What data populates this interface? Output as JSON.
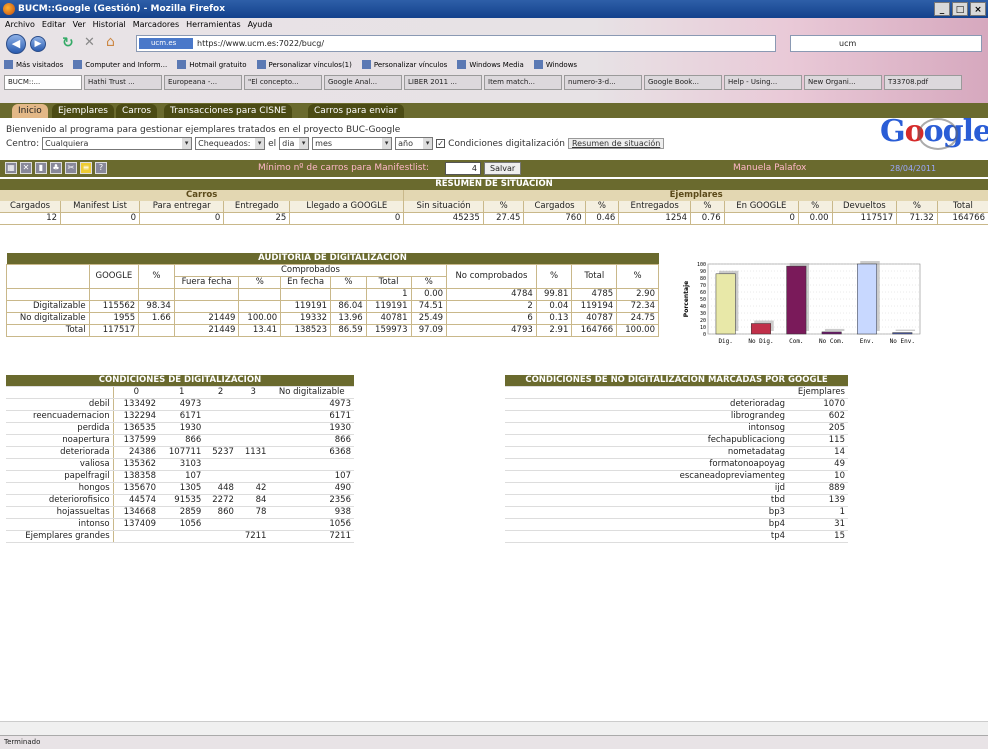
{
  "window": {
    "title": "BUCM::Google (Gestión) - Mozilla Firefox",
    "controls": [
      "_",
      "□",
      "×"
    ]
  },
  "menu": [
    "Archivo",
    "Editar",
    "Ver",
    "Historial",
    "Marcadores",
    "Herramientas",
    "Ayuda"
  ],
  "url": {
    "site": "ucm.es",
    "value": "https://www.ucm.es:7022/bucg/"
  },
  "search": {
    "value": "ucm"
  },
  "bookmarks": [
    "Más visitados",
    "Computer and Inform...",
    "Hotmail gratuito",
    "Personalizar vínculos(1)",
    "Personalizar vínculos",
    "Windows Media",
    "Windows"
  ],
  "browser_tabs": [
    "BUCM::...",
    "Hathi Trust ...",
    "Europeana -...",
    "\"El concepto...",
    "Google Anal...",
    "LIBER 2011 ...",
    "Item match...",
    "numero-3-d...",
    "Google Book...",
    "Help - Using...",
    "New Organi...",
    "T33708.pdf"
  ],
  "app_tabs": [
    "Inicio",
    "Ejemplares",
    "Carros",
    "Transacciones para CISNE",
    "Carros para enviar"
  ],
  "welcome": "Bienvenido al programa para gestionar ejemplares tratados en el proyecto BUC-Google",
  "filters": {
    "centro_label": "Centro:",
    "centro_value": "Cualquiera",
    "chequeados": "Chequeados:",
    "el": "el",
    "dia": "dia",
    "mes": "mes",
    "anio": "año",
    "check_mark": "✓",
    "cond_label": "Condiciones digitalización",
    "resumen_btn": "Resumen de situación"
  },
  "logo": "Google",
  "toolbar": {
    "min_label": "Mínimo nº de carros para Manifestlist:",
    "min_value": "4",
    "salvar": "Salvar",
    "user": "Manuela Palafox",
    "date": "28/04/2011"
  },
  "resumen": {
    "title": "RESUMEN DE SITUACION",
    "group_carros": "Carros",
    "group_ejemplares": "Ejemplares",
    "headers": [
      "Cargados",
      "Manifest List",
      "Para entregar",
      "Entregado",
      "Llegado a GOOGLE",
      "Sin situación",
      "%",
      "Cargados",
      "%",
      "Entregados",
      "%",
      "En GOOGLE",
      "%",
      "Devueltos",
      "%",
      "Total"
    ],
    "values": [
      "12",
      "0",
      "0",
      "25",
      "0",
      "45235",
      "27.45",
      "760",
      "0.46",
      "1254",
      "0.76",
      "0",
      "0.00",
      "117517",
      "71.32",
      "164766"
    ]
  },
  "auditoria": {
    "title": "AUDITORIA DE DIGITALIZACION",
    "h_google": "GOOGLE",
    "h_pct": "%",
    "h_comprobados": "Comprobados",
    "h_fuera": "Fuera fecha",
    "h_pct2": "%",
    "h_en": "En fecha",
    "h_pct3": "%",
    "h_total": "Total",
    "h_pct4": "%",
    "h_nocomp": "No comprobados",
    "h_pct5": "%",
    "h_total2": "Total",
    "h_pct6": "%",
    "rows": [
      [
        "",
        "",
        "",
        "",
        "",
        "",
        "",
        "1",
        "0.00",
        "4784",
        "99.81",
        "4785",
        "2.90"
      ],
      [
        "Digitalizable",
        "115562",
        "98.34",
        "",
        "",
        "119191",
        "86.04",
        "119191",
        "74.51",
        "2",
        "0.04",
        "119194",
        "72.34"
      ],
      [
        "No digitalizable",
        "1955",
        "1.66",
        "21449",
        "100.00",
        "19332",
        "13.96",
        "40781",
        "25.49",
        "6",
        "0.13",
        "40787",
        "24.75"
      ],
      [
        "Total",
        "117517",
        "",
        "21449",
        "13.41",
        "138523",
        "86.59",
        "159973",
        "97.09",
        "4793",
        "2.91",
        "164766",
        "100.00"
      ]
    ]
  },
  "chart_data": {
    "type": "bar",
    "ylabel": "Porcentaje",
    "categories": [
      "Dig.",
      "No Dig.",
      "Com.",
      "No Com.",
      "Env.",
      "No Env."
    ],
    "values": [
      86,
      15,
      97,
      3,
      100,
      2
    ],
    "colors": [
      "#e8e8a8",
      "#c0304a",
      "#7a1a5a",
      "#6a1a6a",
      "#c8d8ff",
      "#4a5aa8"
    ],
    "ylim": [
      0,
      100
    ],
    "yticks": [
      "100",
      "90",
      "80",
      "70",
      "60",
      "50",
      "40",
      "30",
      "20",
      "10",
      "0"
    ]
  },
  "condiciones": {
    "title": "CONDICIONES DE DIGITALIZACION",
    "headers": [
      "",
      "0",
      "1",
      "2",
      "3",
      "No digitalizable"
    ],
    "rows": [
      [
        "debil",
        "133492",
        "4973",
        "",
        "",
        "4973"
      ],
      [
        "reencuadernacion",
        "132294",
        "6171",
        "",
        "",
        "6171"
      ],
      [
        "perdida",
        "136535",
        "1930",
        "",
        "",
        "1930"
      ],
      [
        "noapertura",
        "137599",
        "866",
        "",
        "",
        "866"
      ],
      [
        "deteriorada",
        "24386",
        "107711",
        "5237",
        "1131",
        "6368"
      ],
      [
        "valiosa",
        "135362",
        "3103",
        "",
        "",
        ""
      ],
      [
        "papelfragil",
        "138358",
        "107",
        "",
        "",
        "107"
      ],
      [
        "hongos",
        "135670",
        "1305",
        "448",
        "42",
        "490"
      ],
      [
        "deteriorofisico",
        "44574",
        "91535",
        "2272",
        "84",
        "2356"
      ],
      [
        "hojassueltas",
        "134668",
        "2859",
        "860",
        "78",
        "938"
      ],
      [
        "intonso",
        "137409",
        "1056",
        "",
        "",
        "1056"
      ],
      [
        "Ejemplares grandes",
        "",
        "",
        "",
        "7211",
        "7211"
      ]
    ]
  },
  "nodig": {
    "title": "CONDICIONES DE NO DIGITALIZACION MARCADAS POR GOOGLE",
    "header": "Ejemplares",
    "rows": [
      [
        "deterioradag",
        "1070"
      ],
      [
        "librograndeg",
        "602"
      ],
      [
        "intonsog",
        "205"
      ],
      [
        "fechapublicaciong",
        "115"
      ],
      [
        "nometadatag",
        "14"
      ],
      [
        "formatonoapoyag",
        "49"
      ],
      [
        "escaneadopreviamenteg",
        "10"
      ],
      [
        "ijd",
        "889"
      ],
      [
        "tbd",
        "139"
      ],
      [
        "bp3",
        "1"
      ],
      [
        "bp4",
        "31"
      ],
      [
        "tp4",
        "15"
      ]
    ]
  },
  "status": "Terminado"
}
